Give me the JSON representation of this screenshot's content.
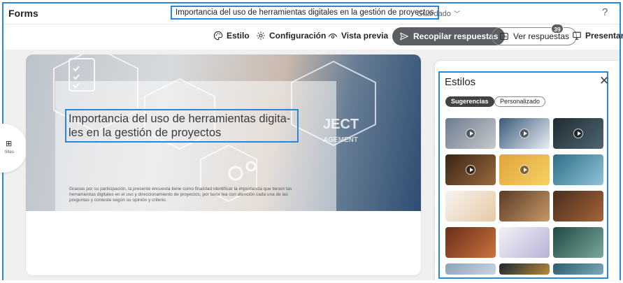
{
  "topbar": {
    "app_name": "Forms",
    "doc_title": "Importancia del uso de herramientas digitales en la gestión de proyectos",
    "saved_label": "Guardado",
    "help_label": "?"
  },
  "toolbar": {
    "style_label": "Estilo",
    "settings_label": "Configuración",
    "preview_label": "Vista previa",
    "collect_label": "Recopilar respuestas",
    "responses_label": "Ver respuestas",
    "responses_count": "39",
    "present_label": "Presentar"
  },
  "side": {
    "label": "tillas"
  },
  "form": {
    "title": "Importancia del uso de herramientas digita-les en la gestión de proyectos",
    "description": "Gracias por su participación, la presente encuesta tiene como finalidad identificar la importancia que tienen las herramientas digitales en el uso y direccionamiento de proyectos, por favor lea con atención cada una de las preguntas y conteste según su opinión y criterio."
  },
  "styles_panel": {
    "title": "Estilos",
    "close_label": "✕",
    "tabs": [
      "Sugerencias",
      "Personalizado"
    ],
    "active_tab": "Sugerencias",
    "thumbnails": [
      {
        "name": "technology-hand",
        "colors": [
          "#6b7c8f",
          "#c7c9cc"
        ],
        "video": true
      },
      {
        "name": "mountain-peaks",
        "colors": [
          "#3c5a7a",
          "#e7eef4"
        ],
        "video": true
      },
      {
        "name": "dark-water",
        "colors": [
          "#1f2c33",
          "#4f6570"
        ],
        "video": true
      },
      {
        "name": "space-planet",
        "colors": [
          "#3a2417",
          "#9b6a3e"
        ],
        "video": true
      },
      {
        "name": "birthday-candles",
        "colors": [
          "#e0a43a",
          "#f6d064"
        ],
        "video": true
      },
      {
        "name": "ocean-waves",
        "colors": [
          "#2f6e8a",
          "#8fc3d6"
        ],
        "video": false
      },
      {
        "name": "person-illustration",
        "colors": [
          "#f7f3ef",
          "#e7c9a6"
        ],
        "video": false
      },
      {
        "name": "restaurant-dinner",
        "colors": [
          "#5a3b27",
          "#c79867"
        ],
        "video": false
      },
      {
        "name": "food-table",
        "colors": [
          "#4a2e1d",
          "#a5643a"
        ],
        "video": false
      },
      {
        "name": "holiday-feast",
        "colors": [
          "#6a2e1c",
          "#c9743e"
        ],
        "video": false
      },
      {
        "name": "people-illustration",
        "colors": [
          "#f2f1f6",
          "#b8b2d8"
        ],
        "video": false
      },
      {
        "name": "christmas-lights",
        "colors": [
          "#1f4a44",
          "#79a79c"
        ],
        "video": false
      },
      {
        "name": "winter-scene",
        "colors": [
          "#8da2b8",
          "#c8d5e2"
        ],
        "video": false
      },
      {
        "name": "city-night",
        "colors": [
          "#1d2633",
          "#b58a3a"
        ],
        "video": false
      },
      {
        "name": "teal-water",
        "colors": [
          "#2d5d6e",
          "#7aa9b6"
        ],
        "video": false
      }
    ]
  },
  "colors": {
    "accent_annotation": "#2b88d8",
    "primary_button": "#5b5f63",
    "canvas_background": "#f0f0f0"
  }
}
